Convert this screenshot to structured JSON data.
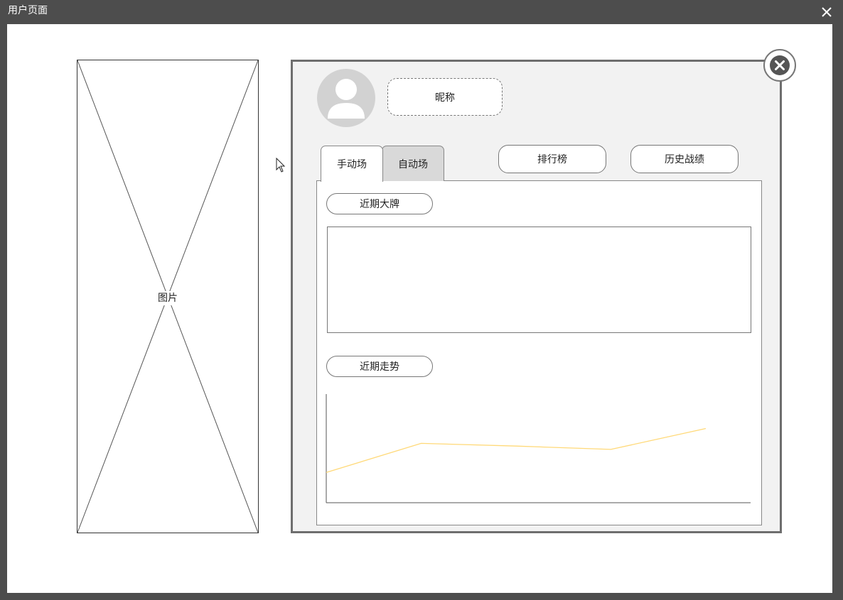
{
  "window": {
    "title": "用户页面",
    "close_icon": "close-icon"
  },
  "image_placeholder": {
    "label": "图片"
  },
  "profile": {
    "avatar_icon": "user-avatar-icon",
    "nickname": "昵称"
  },
  "tabs": [
    {
      "label": "手动场",
      "active": true
    },
    {
      "label": "自动场",
      "active": false
    }
  ],
  "buttons": {
    "rank": "排行榜",
    "history": "历史战绩"
  },
  "sections": {
    "recent_cards": "近期大牌",
    "recent_trend": "近期走势"
  },
  "chart_data": {
    "type": "line",
    "x": [
      0,
      1,
      2,
      3,
      4
    ],
    "series": [
      {
        "values": [
          2.0,
          7.3,
          6.8,
          6.2,
          10.0
        ],
        "color": "#ffd978"
      }
    ],
    "xlim": [
      0,
      4.45
    ],
    "ylim": [
      -3.5,
      16
    ],
    "grid": false,
    "title": "",
    "xlabel": "",
    "ylabel": ""
  }
}
